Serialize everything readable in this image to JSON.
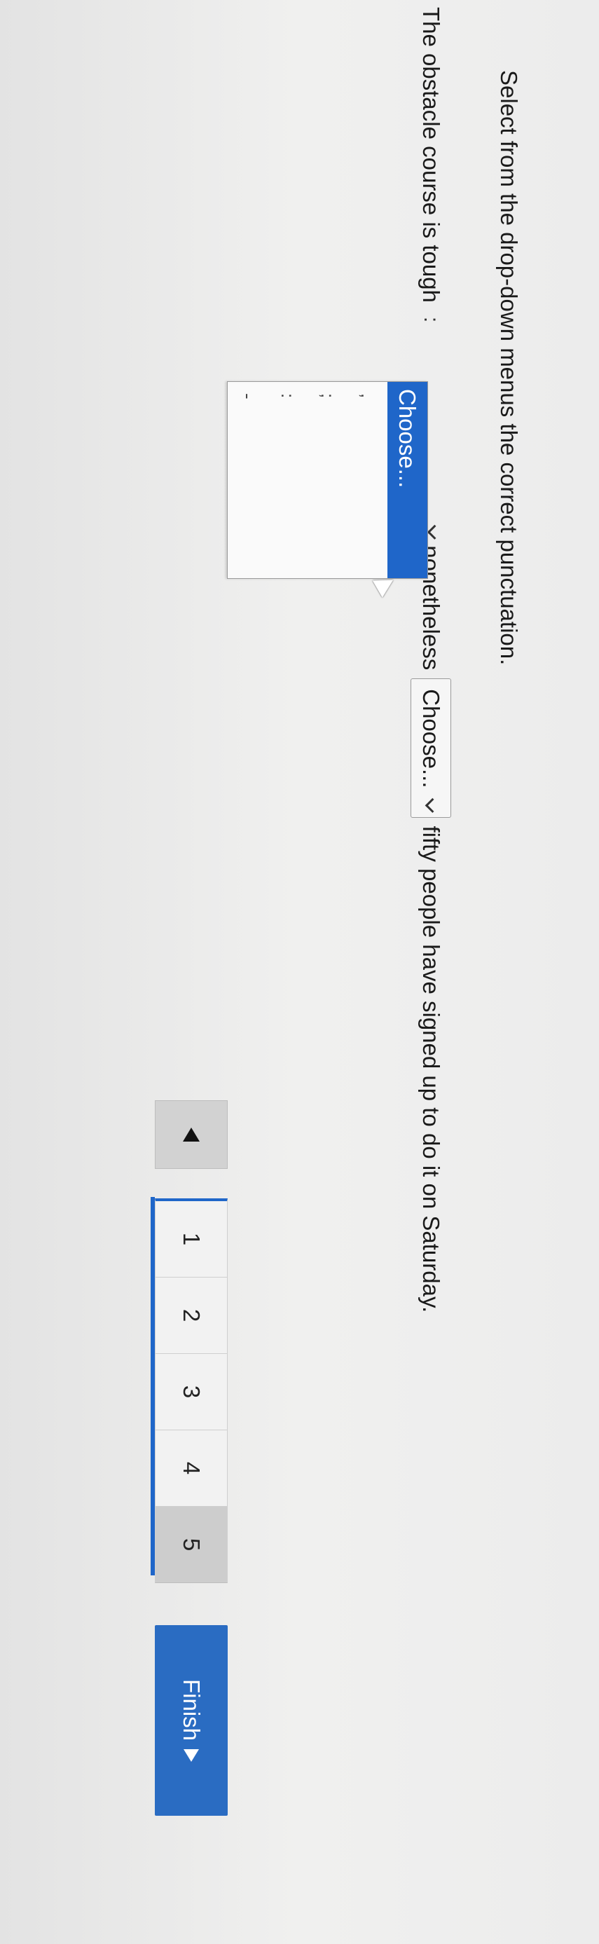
{
  "instruction": "Select from the drop-down menus the correct punctuation.",
  "sentence": {
    "part1": "The obstacle course is tough",
    "separator": ":",
    "part2": "nonetheless",
    "part3": "fifty people have signed up to do it on Saturday."
  },
  "dropdown1": {
    "selected_label": "Choose...",
    "options": [
      "Choose...",
      ",",
      ";",
      ":",
      "-"
    ]
  },
  "dropdown2": {
    "selected_label": "Choose..."
  },
  "pagination": {
    "pages": [
      "1",
      "2",
      "3",
      "4",
      "5"
    ],
    "current_page": "5",
    "finish_label": "Finish"
  },
  "icons": {
    "chevron": "chevron-down-icon",
    "prev": "triangle-left-icon",
    "next": "triangle-right-icon"
  },
  "colors": {
    "accent": "#1f66c9",
    "finish_button": "#2a6cc2"
  }
}
